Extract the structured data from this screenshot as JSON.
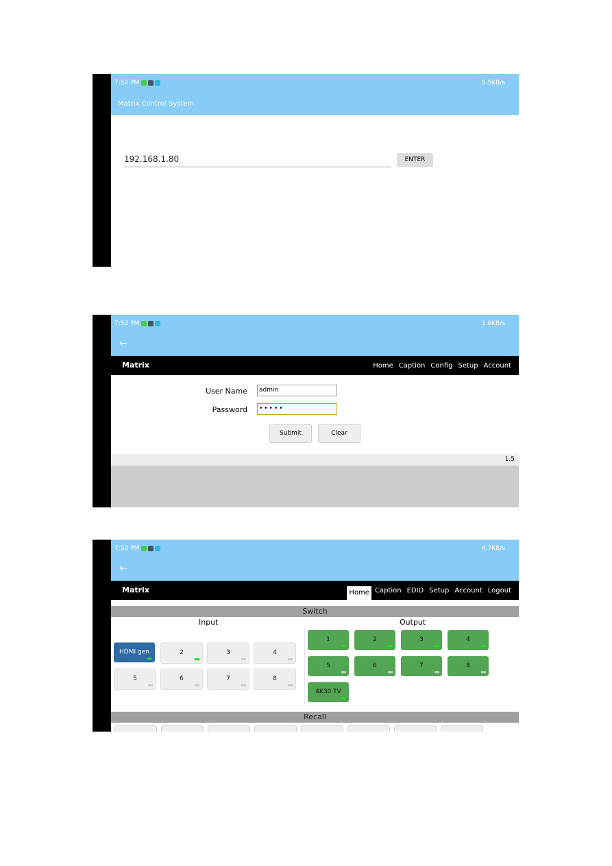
{
  "status": {
    "time": "7:52 PM"
  },
  "screen1": {
    "net": "5.5KB/s",
    "title": "Matrix Control System",
    "ip_value": "192.168.1.80",
    "enter": "ENTER"
  },
  "screen2": {
    "net": "1.6KB/s",
    "brand": "Matrix",
    "nav": [
      "Home",
      "Caption",
      "Config",
      "Setup",
      "Account"
    ],
    "username_label": "User Name",
    "username_value": "admin",
    "password_label": "Password",
    "password_value": "•••••",
    "submit": "Submit",
    "clear": "Clear",
    "version": "1.5"
  },
  "screen3": {
    "net": "4.7KB/s",
    "brand": "Matrix",
    "nav": [
      "Home",
      "Caption",
      "EDID",
      "Setup",
      "Account",
      "Logout"
    ],
    "active_nav": "Home",
    "switch_title": "Switch",
    "input_title": "Input",
    "output_title": "Output",
    "recall_title": "Recall",
    "inputs": [
      {
        "label": "HDMI gen",
        "selected": true,
        "signal": true
      },
      {
        "label": "2",
        "signal": true
      },
      {
        "label": "3",
        "signal": false
      },
      {
        "label": "4",
        "signal": false
      },
      {
        "label": "5",
        "signal": false
      },
      {
        "label": "6",
        "signal": false
      },
      {
        "label": "7",
        "signal": false
      },
      {
        "label": "8",
        "signal": false
      }
    ],
    "outputs": [
      {
        "label": "1",
        "signal": true
      },
      {
        "label": "2",
        "signal": true
      },
      {
        "label": "3",
        "signal": true
      },
      {
        "label": "4",
        "signal": true
      },
      {
        "label": "5",
        "signal": false
      },
      {
        "label": "6",
        "signal": false
      },
      {
        "label": "7",
        "signal": false
      },
      {
        "label": "8",
        "signal": false
      },
      {
        "label": "4K30 TV",
        "signal": true
      }
    ]
  },
  "colors": {
    "statusbar": "#87cbf7",
    "selected_input": "#2f6aa3",
    "output": "#52a552",
    "signal_on": "#22dd22",
    "signal_off": "#cccccc"
  }
}
